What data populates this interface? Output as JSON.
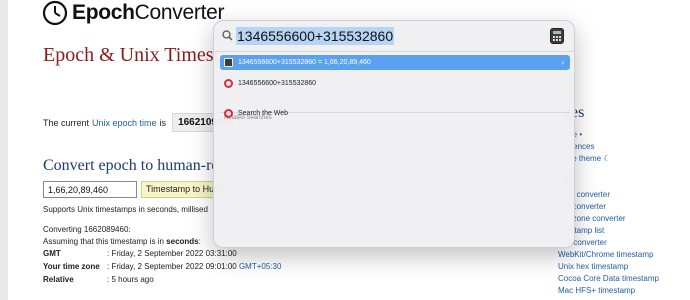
{
  "page": {
    "logo_bold": "Epoch",
    "logo_rest": "Converter",
    "heading": "Epoch & Unix Timest",
    "current_prefix": "The current",
    "current_link": "Unix epoch time",
    "current_suffix": "is",
    "current_epoch": "1662109496",
    "convert_heading": "Convert epoch to human-re",
    "epoch_input_value": "1,66,20,89,460",
    "timestamp_button": "Timestamp to Hum",
    "supports_text": "Supports Unix timestamps in seconds, millised",
    "converting_text": "Converting 1662089460:",
    "assuming_prefix": "Assuming that this timestamp is in",
    "assuming_bold": "seconds",
    "assuming_suffix": ":",
    "rows": [
      {
        "label": "GMT",
        "value": ": Friday, 2 September 2022 03:31:00",
        "link": ""
      },
      {
        "label": "Your time zone",
        "value": ": Friday, 2 September 2022 09:01:00",
        "link": "GMT+05:30"
      },
      {
        "label": "Relative",
        "value": ": 5 hours ago",
        "link": ""
      }
    ]
  },
  "sidebar": {
    "heading": "ges",
    "links_top": [
      "me •",
      "erences",
      "gle theme ☾"
    ],
    "section": "s",
    "links": [
      "ch converter",
      "h converter",
      "e zone converter",
      "estamp list",
      "P converter",
      "WebKit/Chrome timestamp",
      "Unix hex timestamp",
      "Cocoa Core Data timestamp",
      "Mac HFS+ timestamp"
    ]
  },
  "spotlight": {
    "query": "1346556600+315532860",
    "results": [
      {
        "icon": "calculator-icon",
        "text": "1346556600+315532860 = 1,66,20,89,460",
        "selected": true
      },
      {
        "icon": "opera-icon",
        "text": "1346556600+315532860",
        "selected": false
      }
    ],
    "section_label": "Related Searches",
    "related": [
      {
        "icon": "opera-icon",
        "text": "Search the Web"
      }
    ],
    "colors": {
      "selection": "#5aa2f0",
      "query_highlight": "#b6d4f5",
      "opera": "#e0293a"
    }
  }
}
